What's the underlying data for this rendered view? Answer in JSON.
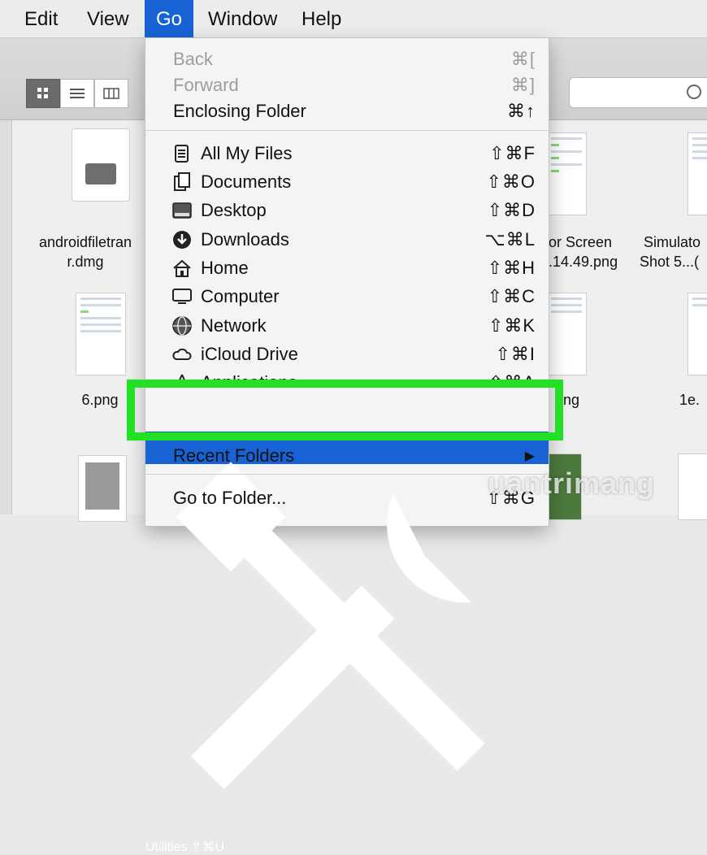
{
  "menubar": {
    "items": [
      "Edit",
      "View",
      "Go",
      "Window",
      "Help"
    ]
  },
  "files": {
    "row1": [
      "androidfiletran",
      "r.dmg",
      "or Screen",
      ".14.49.png",
      "Simulato",
      "Shot 5...("
    ],
    "row2": [
      "6.png",
      "ng",
      "1e."
    ]
  },
  "go_menu": {
    "back": {
      "label": "Back",
      "shortcut": "⌘["
    },
    "forward": {
      "label": "Forward",
      "shortcut": "⌘]"
    },
    "enclosing": {
      "label": "Enclosing Folder",
      "shortcut": "⌘↑"
    },
    "all_my_files": {
      "label": "All My Files",
      "shortcut": "⇧⌘F",
      "icon": "all-files-icon"
    },
    "documents": {
      "label": "Documents",
      "shortcut": "⇧⌘O",
      "icon": "documents-icon"
    },
    "desktop": {
      "label": "Desktop",
      "shortcut": "⇧⌘D",
      "icon": "desktop-icon"
    },
    "downloads": {
      "label": "Downloads",
      "shortcut": "⌥⌘L",
      "icon": "downloads-icon"
    },
    "home": {
      "label": "Home",
      "shortcut": "⇧⌘H",
      "icon": "home-icon"
    },
    "computer": {
      "label": "Computer",
      "shortcut": "⇧⌘C",
      "icon": "computer-icon"
    },
    "network": {
      "label": "Network",
      "shortcut": "⇧⌘K",
      "icon": "network-icon"
    },
    "icloud": {
      "label": "iCloud Drive",
      "shortcut": "⇧⌘I",
      "icon": "cloud-icon"
    },
    "applications": {
      "label": "Applications",
      "shortcut": "⇧⌘A",
      "icon": "applications-icon"
    },
    "utilities": {
      "label": "Utilities",
      "shortcut": "⇧⌘U",
      "icon": "utilities-icon"
    },
    "recent": {
      "label": "Recent Folders",
      "shortcut": "▶"
    },
    "goto": {
      "label": "Go to Folder...",
      "shortcut": "⇧⌘G"
    }
  },
  "watermark": "uantrimang",
  "colors": {
    "highlight": "#1763d6",
    "annotation_box": "#22e026"
  }
}
